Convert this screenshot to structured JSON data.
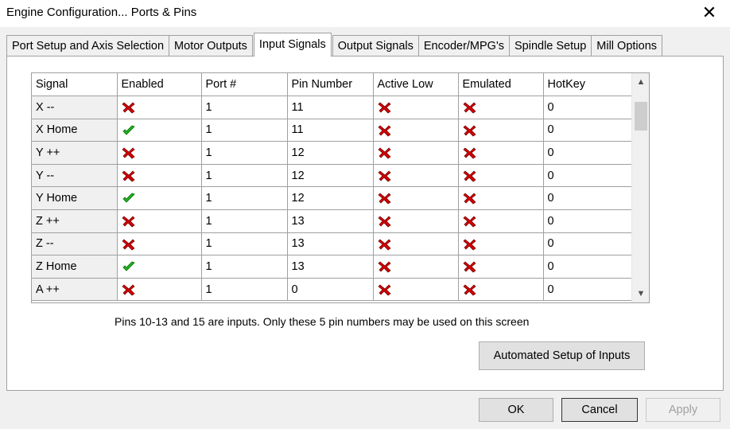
{
  "window": {
    "title": "Engine Configuration... Ports & Pins"
  },
  "tabs": [
    {
      "label": "Port Setup and Axis Selection",
      "active": false
    },
    {
      "label": "Motor Outputs",
      "active": false
    },
    {
      "label": "Input Signals",
      "active": true
    },
    {
      "label": "Output Signals",
      "active": false
    },
    {
      "label": "Encoder/MPG's",
      "active": false
    },
    {
      "label": "Spindle Setup",
      "active": false
    },
    {
      "label": "Mill Options",
      "active": false
    }
  ],
  "grid": {
    "columns": [
      "Signal",
      "Enabled",
      "Port #",
      "Pin Number",
      "Active Low",
      "Emulated",
      "HotKey"
    ],
    "rows": [
      {
        "signal": "X --",
        "enabled": false,
        "port": "1",
        "pin": "11",
        "active_low": false,
        "emulated": false,
        "hotkey": "0"
      },
      {
        "signal": "X Home",
        "enabled": true,
        "port": "1",
        "pin": "11",
        "active_low": false,
        "emulated": false,
        "hotkey": "0"
      },
      {
        "signal": "Y ++",
        "enabled": false,
        "port": "1",
        "pin": "12",
        "active_low": false,
        "emulated": false,
        "hotkey": "0"
      },
      {
        "signal": "Y --",
        "enabled": false,
        "port": "1",
        "pin": "12",
        "active_low": false,
        "emulated": false,
        "hotkey": "0"
      },
      {
        "signal": "Y Home",
        "enabled": true,
        "port": "1",
        "pin": "12",
        "active_low": false,
        "emulated": false,
        "hotkey": "0"
      },
      {
        "signal": "Z ++",
        "enabled": false,
        "port": "1",
        "pin": "13",
        "active_low": false,
        "emulated": false,
        "hotkey": "0"
      },
      {
        "signal": "Z --",
        "enabled": false,
        "port": "1",
        "pin": "13",
        "active_low": false,
        "emulated": false,
        "hotkey": "0"
      },
      {
        "signal": "Z Home",
        "enabled": true,
        "port": "1",
        "pin": "13",
        "active_low": false,
        "emulated": false,
        "hotkey": "0"
      },
      {
        "signal": "A ++",
        "enabled": false,
        "port": "1",
        "pin": "0",
        "active_low": false,
        "emulated": false,
        "hotkey": "0"
      }
    ]
  },
  "info_text": "Pins 10-13 and 15 are inputs. Only these 5 pin numbers may be used on this screen",
  "buttons": {
    "auto_setup": "Automated Setup of Inputs",
    "ok": "OK",
    "cancel": "Cancel",
    "apply": "Apply"
  },
  "colors": {
    "check": "#1fb51f",
    "cross": "#d20000"
  },
  "icons": {
    "close": "close-icon",
    "check": "green-check-icon",
    "cross": "red-x-icon"
  }
}
